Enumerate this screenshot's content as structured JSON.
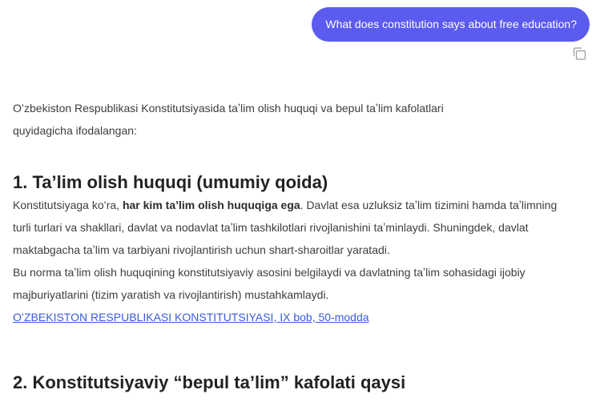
{
  "user_message": {
    "text": "What does constitution says about free education?",
    "copy_icon": "copy-icon"
  },
  "answer": {
    "intro": "Oʻzbekiston Respublikasi Konstitutsiyasida taʼlim olish huquqi va bepul taʼlim kafolatlari quyidagicha ifodalangan:",
    "section1": {
      "heading": "1. Ta’lim olish huquqi (umumiy qoida)",
      "p1_before": "Konstitutsiyaga koʻra, ",
      "p1_bold": "har kim taʼlim olish huquqiga ega",
      "p1_after": ". Davlat esa uzluksiz taʼlim tizimini hamda taʼlimning turli turlari va shakllari, davlat va nodavlat taʼlim tashkilotlari rivojlanishini taʼminlaydi. Shuningdek, davlat maktabgacha taʼlim va tarbiyani rivojlantirish uchun shart-sharoitlar yaratadi.",
      "p2": "Bu norma taʼlim olish huquqining konstitutsiyaviy asosini belgilaydi va davlatning taʼlim sohasidagi ijobiy majburiyatlarini (tizim yaratish va rivojlantirish) mustahkamlaydi.",
      "source_link": "OʻZBEKISTON RESPUBLIKASI KONSTITUTSIYASI, IX bob, 50-modda"
    },
    "section2": {
      "heading": "2. Konstitutsiyaviy “bepul ta’lim” kafolati qaysi"
    }
  },
  "colors": {
    "user_bubble": "#5b5bf0",
    "link": "#3b5bdb",
    "heading": "#222222",
    "body_text": "#3d3d3d"
  }
}
